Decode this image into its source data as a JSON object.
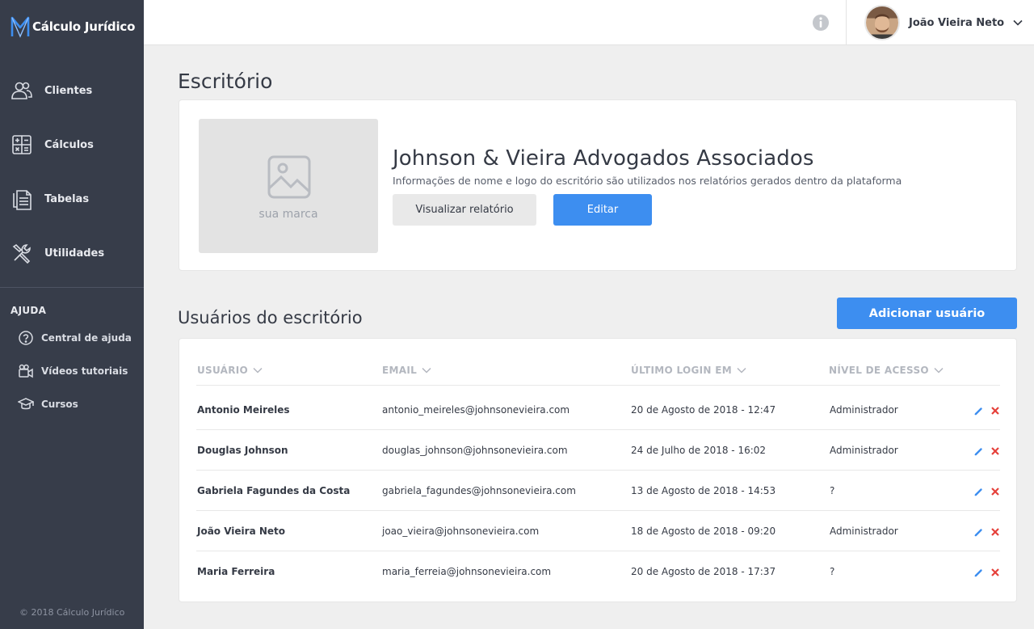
{
  "brand": {
    "name": "Cálculo Jurídico",
    "accent": "#3d8ef0"
  },
  "sidebar": {
    "items": [
      {
        "label": "Clientes",
        "icon": "users-icon"
      },
      {
        "label": "Cálculos",
        "icon": "calculator-icon"
      },
      {
        "label": "Tabelas",
        "icon": "document-icon"
      },
      {
        "label": "Utilidades",
        "icon": "tools-icon"
      }
    ],
    "help_title": "AJUDA",
    "help_items": [
      {
        "label": "Central de ajuda",
        "icon": "help-circle-icon"
      },
      {
        "label": "Vídeos tutoriais",
        "icon": "video-icon"
      },
      {
        "label": "Cursos",
        "icon": "graduation-cap-icon"
      }
    ],
    "copyright": "© 2018 Cálculo Jurídico"
  },
  "topbar": {
    "user_name": "João Vieira Neto"
  },
  "page": {
    "title": "Escritório"
  },
  "office": {
    "brand_placeholder": "sua marca",
    "name": "Johnson & Vieira Advogados Associados",
    "description": "Informações de nome e logo do escritório são utilizados nos relatórios gerados dentro da plataforma",
    "view_report_label": "Visualizar relatório",
    "edit_label": "Editar"
  },
  "users": {
    "title": "Usuários do escritório",
    "add_label": "Adicionar usuário",
    "columns": [
      "USUÁRIO",
      "EMAIL",
      "ÚLTIMO LOGIN EM",
      "NÍVEL DE ACESSO"
    ],
    "rows": [
      {
        "name": "Antonio Meireles",
        "email": "antonio_meireles@johnsonevieira.com",
        "last_login": "20 de Agosto de 2018 - 12:47",
        "access": "Administrador"
      },
      {
        "name": "Douglas Johnson",
        "email": "douglas_johnson@johnsonevieira.com",
        "last_login": "24 de Julho de 2018 - 16:02",
        "access": "Administrador"
      },
      {
        "name": "Gabriela Fagundes da Costa",
        "email": "gabriela_fagundes@johnsonevieira.com",
        "last_login": "13 de Agosto de 2018 - 14:53",
        "access": "?"
      },
      {
        "name": "João Vieira Neto",
        "email": "joao_vieira@johnsonevieira.com",
        "last_login": "18 de Agosto de 2018 - 09:20",
        "access": "Administrador"
      },
      {
        "name": "Maria Ferreira",
        "email": "maria_ferreia@johnsonevieira.com",
        "last_login": "20 de Agosto de 2018 - 17:37",
        "access": "?"
      }
    ]
  }
}
